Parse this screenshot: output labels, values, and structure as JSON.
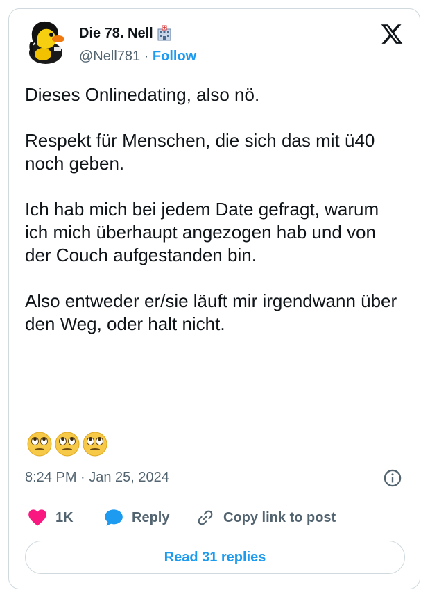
{
  "author": {
    "name": "Die 78. Nell",
    "handle": "@Nell781",
    "separator": "·",
    "follow_label": "Follow"
  },
  "tweet": {
    "text": "Dieses Onlinedating, also nö.\n\nRespekt für Menschen, die sich das mit ü40 noch geben.\n\nIch hab mich bei jedem Date gefragt, warum ich mich überhaupt angezogen hab und von der Couch aufgestanden bin.\n\nAlso entweder er/sie läuft mir irgendwann über den Weg, oder halt nicht.",
    "emoji_count": 3,
    "timestamp": "8:24 PM · Jan 25, 2024"
  },
  "actions": {
    "likes": "1K",
    "reply_label": "Reply",
    "copy_label": "Copy link to post"
  },
  "read_replies_label": "Read 31 replies",
  "icons": {
    "avatar": "rubber-duck-avatar",
    "badge": "hospital-emoji",
    "logo": "x-logo",
    "emoji": "face-with-rolling-eyes",
    "info": "info-icon",
    "like": "heart-icon",
    "reply": "speech-bubble-icon",
    "copy": "link-icon"
  },
  "colors": {
    "accent": "#1d9bf0",
    "like": "#f91880",
    "text": "#0f1419",
    "muted": "#536471",
    "border": "#cfd9de"
  }
}
